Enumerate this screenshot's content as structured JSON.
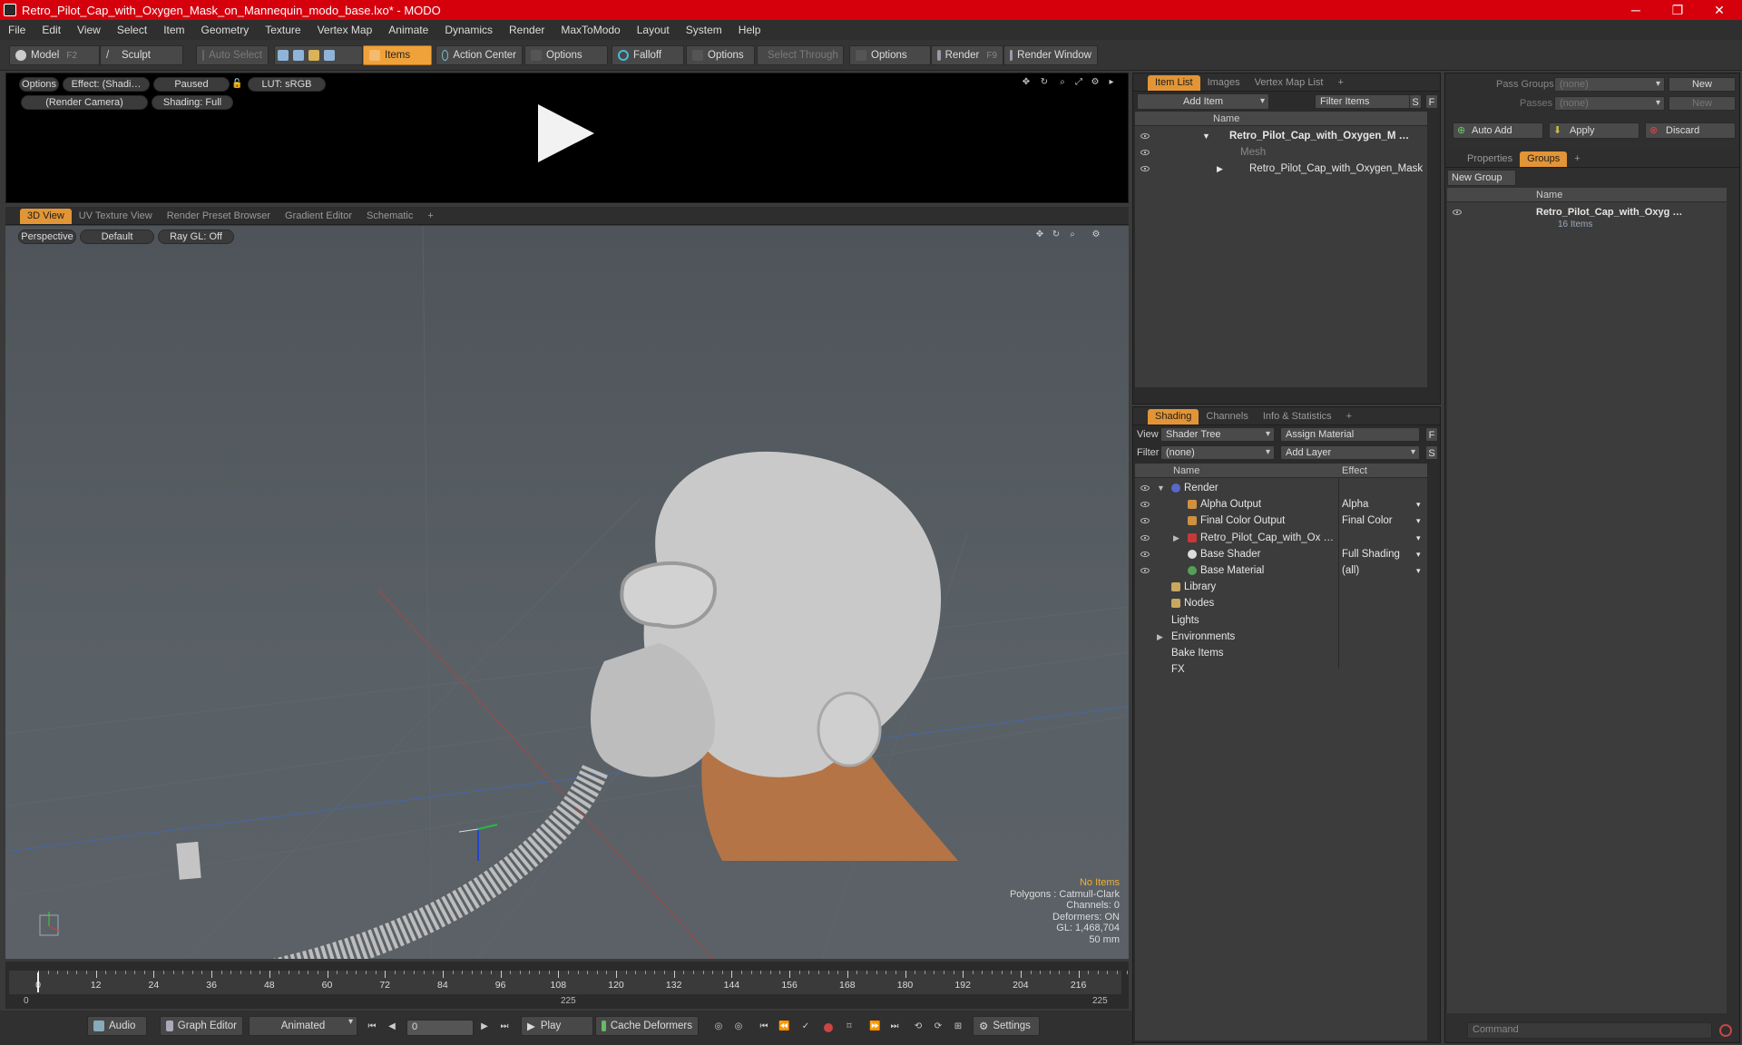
{
  "window": {
    "title": "Retro_Pilot_Cap_with_Oxygen_Mask_on_Mannequin_modo_base.lxo* - MODO",
    "minimize": "─",
    "maximize": "❐",
    "close": "✕"
  },
  "menu": [
    "File",
    "Edit",
    "View",
    "Select",
    "Item",
    "Geometry",
    "Texture",
    "Vertex Map",
    "Animate",
    "Dynamics",
    "Render",
    "MaxToModo",
    "Layout",
    "System",
    "Help"
  ],
  "toolbar": {
    "model": "Model",
    "model_key": "F2",
    "sculpt": "Sculpt",
    "auto_select": "Auto Select",
    "items": "Items",
    "action_center": "Action Center",
    "options1": "Options",
    "falloff": "Falloff",
    "options2": "Options",
    "select_through": "Select Through",
    "options3": "Options",
    "render": "Render",
    "render_key": "F9",
    "render_window": "Render Window"
  },
  "preview": {
    "options": "Options",
    "effect": "Effect: (Shadi…",
    "paused": "Paused",
    "lut": "LUT: sRGB",
    "camera": "(Render Camera)",
    "shading": "Shading: Full"
  },
  "viewport": {
    "tabs": [
      "3D View",
      "UV Texture View",
      "Render Preset Browser",
      "Gradient Editor",
      "Schematic",
      "+"
    ],
    "perspective": "Perspective",
    "default": "Default",
    "raygl": "Ray GL: Off",
    "stats": {
      "no_items": "No Items",
      "polygons": "Polygons : Catmull-Clark",
      "channels": "Channels: 0",
      "deformers": "Deformers: ON",
      "gl": "GL: 1,468,704",
      "scale": "50 mm"
    }
  },
  "timeline": {
    "ticks": [
      "0",
      "12",
      "24",
      "36",
      "48",
      "60",
      "72",
      "84",
      "96",
      "108",
      "120",
      "132",
      "144",
      "156",
      "168",
      "180",
      "192",
      "204",
      "216"
    ],
    "start": "0",
    "mid": "225",
    "end": "225"
  },
  "bottombar": {
    "audio": "Audio",
    "graph_editor": "Graph Editor",
    "animated": "Animated",
    "frame": "0",
    "play": "Play",
    "cache": "Cache Deformers",
    "settings": "Settings"
  },
  "itemlist": {
    "tabs": [
      "Item List",
      "Images",
      "Vertex Map List",
      "+"
    ],
    "add_item": "Add Item",
    "filter": "Filter Items",
    "s": "S",
    "f": "F",
    "col_name": "Name",
    "rows": [
      "Retro_Pilot_Cap_with_Oxygen_M …",
      "Mesh",
      "Retro_Pilot_Cap_with_Oxygen_Mask …"
    ]
  },
  "shading": {
    "tabs": [
      "Shading",
      "Channels",
      "Info & Statistics",
      "+"
    ],
    "view_label": "View",
    "view_value": "Shader Tree",
    "assign": "Assign Material",
    "f": "F",
    "filter_label": "Filter",
    "filter_value": "(none)",
    "add_layer": "Add Layer",
    "s": "S",
    "col_name": "Name",
    "col_effect": "Effect",
    "rows": [
      {
        "name": "Render",
        "effect": ""
      },
      {
        "name": "Alpha Output",
        "effect": "Alpha"
      },
      {
        "name": "Final Color Output",
        "effect": "Final Color"
      },
      {
        "name": "Retro_Pilot_Cap_with_Ox …",
        "effect": ""
      },
      {
        "name": "Base Shader",
        "effect": "Full Shading"
      },
      {
        "name": "Base Material",
        "effect": "(all)"
      },
      {
        "name": "Library",
        "effect": ""
      },
      {
        "name": "Nodes",
        "effect": ""
      },
      {
        "name": "Lights",
        "effect": ""
      },
      {
        "name": "Environments",
        "effect": ""
      },
      {
        "name": "Bake Items",
        "effect": ""
      },
      {
        "name": "FX",
        "effect": ""
      }
    ]
  },
  "groups": {
    "pass_groups_label": "Pass Groups",
    "pass_groups_value": "(none)",
    "new1": "New",
    "passes_label": "Passes",
    "passes_value": "(none)",
    "new2": "New",
    "auto_add": "Auto Add",
    "apply": "Apply",
    "discard": "Discard",
    "tabs": [
      "Properties",
      "Groups",
      "+"
    ],
    "new_group": "New Group",
    "col_name": "Name",
    "item_name": "Retro_Pilot_Cap_with_Oxyg …",
    "item_count": "16 Items",
    "command": "Command"
  }
}
